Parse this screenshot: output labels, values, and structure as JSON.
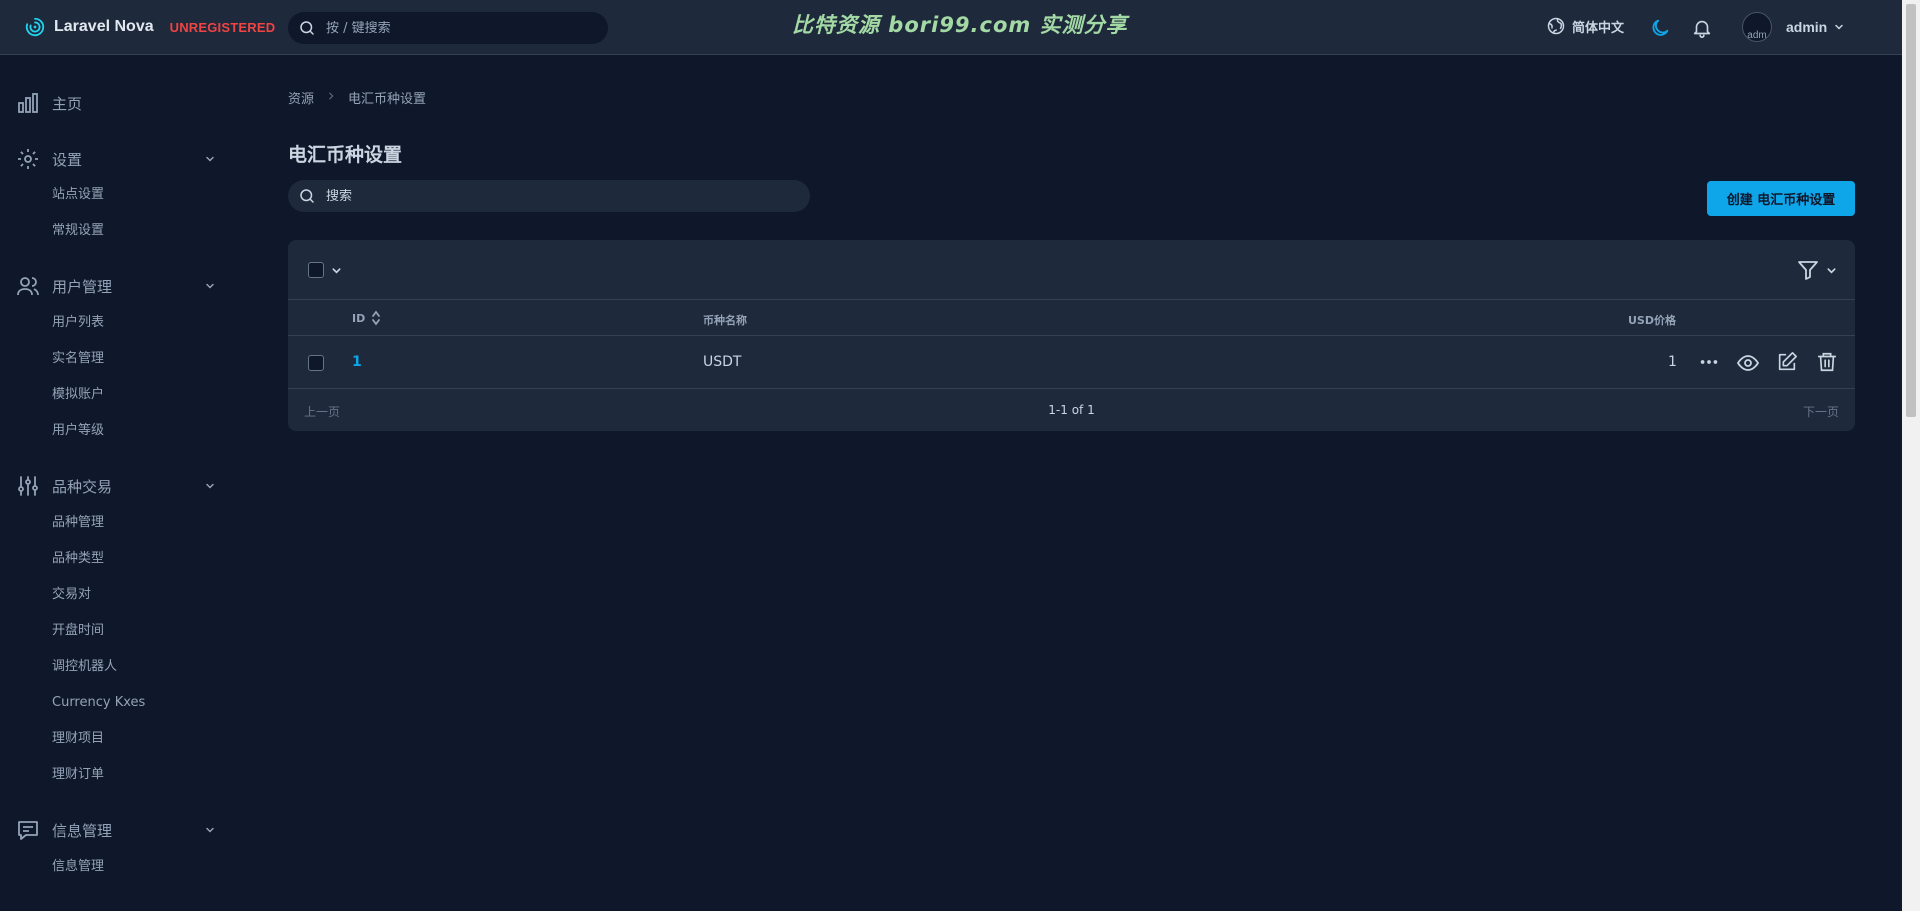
{
  "brand": {
    "name": "Laravel Nova",
    "license": "UNREGISTERED"
  },
  "global_search": {
    "placeholder": "按 / 键搜索"
  },
  "watermark": "比特资源 bori99.com 实测分享",
  "header": {
    "language": "简体中文",
    "user_name": "admin",
    "avatar_alt": "adm"
  },
  "sidebar": {
    "home": "主页",
    "groups": [
      {
        "label": "设置",
        "items": [
          "站点设置",
          "常规设置"
        ]
      },
      {
        "label": "用户管理",
        "items": [
          "用户列表",
          "实名管理",
          "模拟账户",
          "用户等级"
        ]
      },
      {
        "label": "品种交易",
        "items": [
          "品种管理",
          "品种类型",
          "交易对",
          "开盘时间",
          "调控机器人",
          "Currency Kxes",
          "理财项目",
          "理财订单"
        ]
      },
      {
        "label": "信息管理",
        "items": [
          "信息管理"
        ]
      }
    ]
  },
  "breadcrumb": {
    "root": "资源",
    "current": "电汇币种设置"
  },
  "page": {
    "title": "电汇币种设置",
    "search_placeholder": "搜索",
    "create_label": "创建 电汇币种设置"
  },
  "table": {
    "headers": {
      "id": "ID",
      "name": "币种名称",
      "price": "USD价格"
    },
    "rows": [
      {
        "id": "1",
        "name": "USDT",
        "price": "1"
      }
    ]
  },
  "pagination": {
    "prev": "上一页",
    "info": "1-1 of 1",
    "next": "下一页"
  },
  "colors": {
    "accent": "#0ea5e9",
    "background": "#0f172a",
    "panel": "#1e293b",
    "danger": "#ef4444"
  }
}
